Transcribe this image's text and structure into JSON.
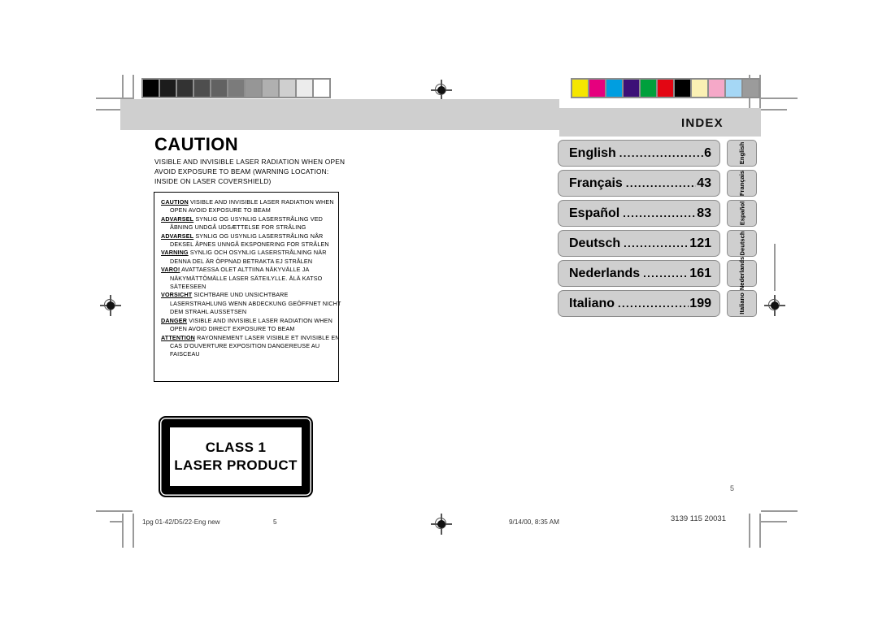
{
  "document": {
    "page_number": "5",
    "index_heading": "INDEX"
  },
  "caution": {
    "title": "CAUTION",
    "subtitle_lines": [
      "VISIBLE AND INVISIBLE LASER RADIATION WHEN OPEN",
      "AVOID EXPOSURE TO BEAM (WARNING LOCATION:",
      "INSIDE ON LASER COVERSHIELD)"
    ]
  },
  "warning_box": {
    "entries": [
      {
        "keyword": "CAUTION",
        "first_line": "VISIBLE AND INVISIBLE LASER RADIATION WHEN",
        "rest_lines": [
          "OPEN AVOID EXPOSURE TO BEAM"
        ]
      },
      {
        "keyword": "ADVARSEL",
        "first_line": "SYNLIG OG USYNLIG LASERSTRÅLING VED",
        "rest_lines": [
          "ÅBNING UNDGÅ UDSÆTTELSE FOR STRÅLING"
        ]
      },
      {
        "keyword": "ADVARSEL",
        "first_line": "SYNLIG OG USYNLIG LASERSTRÅLING NÅR",
        "rest_lines": [
          "DEKSEL ÅPNES UNNGÅ EKSPONERING FOR STRÅLEN"
        ]
      },
      {
        "keyword": "VARNING",
        "first_line": "SYNLIG OCH OSYNLIG LASERSTRÅLNING NÄR",
        "rest_lines": [
          "DENNA DEL ÄR ÖPPNAD BETRAKTA EJ STRÅLEN"
        ]
      },
      {
        "keyword": "VARO!",
        "first_line": "AVATTAESSA OLET ALTTIINA NÄKYVÄLLE JA",
        "rest_lines": [
          "NÄKYMÄTTÖMÄLLE LASER SÄTEILYLLE. ÄLÄ KATSO",
          "SÄTEESEEN"
        ]
      },
      {
        "keyword": "VORSICHT",
        "first_line": "SICHTBARE UND UNSICHTBARE",
        "rest_lines": [
          "LASERSTRAHLUNG WENN ABDECKUNG GEÖFFNET NICHT",
          "DEM STRAHL AUSSETSEN"
        ]
      },
      {
        "keyword": "DANGER",
        "first_line": "VISIBLE AND INVISIBLE LASER RADIATION WHEN",
        "rest_lines": [
          "OPEN AVOID DIRECT EXPOSURE TO BEAM"
        ]
      },
      {
        "keyword": "ATTENTION",
        "first_line": "RAYONNEMENT LASER VISIBLE ET INVISIBLE EN",
        "rest_lines": [
          "CAS D'OUVERTURE EXPOSITION DANGEREUSE AU",
          "FAISCEAU"
        ]
      }
    ]
  },
  "laser_label": {
    "line1": "CLASS 1",
    "line2": "LASER PRODUCT"
  },
  "index": {
    "rows": [
      {
        "language": "English",
        "dots": "......................................",
        "page": "6",
        "tab": "English"
      },
      {
        "language": "Français",
        "dots": "....................................",
        "page": "43",
        "tab": "Français"
      },
      {
        "language": "Español",
        "dots": "...................................",
        "page": "83",
        "tab": "Español"
      },
      {
        "language": "Deutsch",
        "dots": "..................................",
        "page": "121",
        "tab": "Deutsch"
      },
      {
        "language": "Nederlands",
        "dots": "...........................",
        "page": "161",
        "tab": "Nederlands"
      },
      {
        "language": "Italiano",
        "dots": "..............................",
        "page": "199",
        "tab": "Italiano"
      }
    ]
  },
  "footer": {
    "job_name": "1pg 01-42/D5/22-Eng new",
    "sheet_number": "5",
    "timestamp": "9/14/00, 8:35 AM",
    "part_code": "3139 115 20031"
  },
  "control_strips": {
    "grayscale": [
      "#000000",
      "#1c1c1c",
      "#333333",
      "#4e4e4e",
      "#626262",
      "#7b7b7b",
      "#969696",
      "#b0b0b0",
      "#cfcfcf",
      "#ececec",
      "#ffffff"
    ],
    "color": [
      "#f5e600",
      "#e6007e",
      "#009ee0",
      "#3c1077",
      "#00a03c",
      "#e30613",
      "#000000",
      "#faf0b4",
      "#f5a8c8",
      "#a5d7f5",
      "#9b9b9b"
    ]
  },
  "colors": {
    "band_gray": "#cfcfcf",
    "box_border": "#8d8d8d",
    "crop_mark": "#9a9a9a"
  }
}
